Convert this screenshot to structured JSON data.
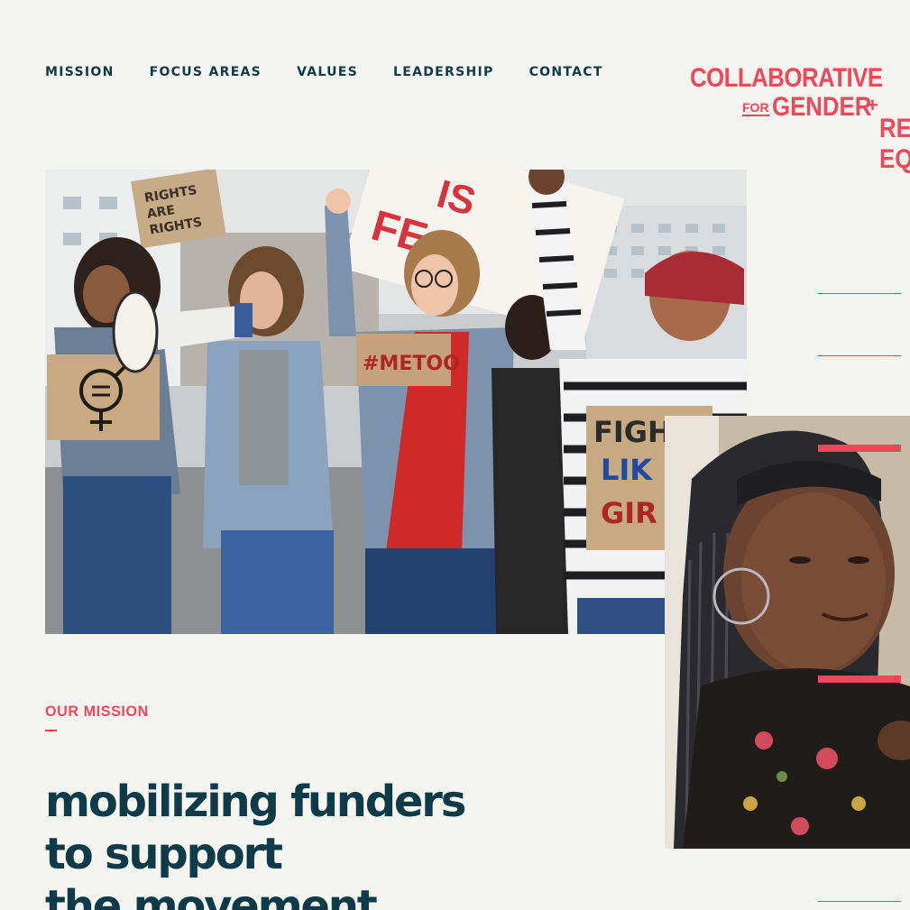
{
  "nav": {
    "items": [
      {
        "label": "MISSION"
      },
      {
        "label": "FOCUS AREAS"
      },
      {
        "label": "VALUES"
      },
      {
        "label": "LEADERSHIP"
      },
      {
        "label": "CONTACT"
      }
    ]
  },
  "logo": {
    "line1": "COLLABORATIVE",
    "for": "FOR",
    "line2": "GENDER",
    "plus": "+",
    "line3a": "RE",
    "line3b": "EQ"
  },
  "hero": {
    "signs": {
      "rights": "RIGHTS",
      "are": "ARE",
      "rights2": "RIGHTS",
      "future_is": "IS",
      "future_fe": "FE",
      "metoo": "#METOO",
      "fight": "FIGH",
      "like": "LIK",
      "girl": "GIR"
    }
  },
  "mission": {
    "eyebrow": "OUR MISSION",
    "headline": [
      "mobilizing funders",
      "to support",
      "the movement"
    ]
  },
  "colors": {
    "accent": "#f0475a",
    "ink": "#0f3a48",
    "background": "#f4f5f0"
  }
}
